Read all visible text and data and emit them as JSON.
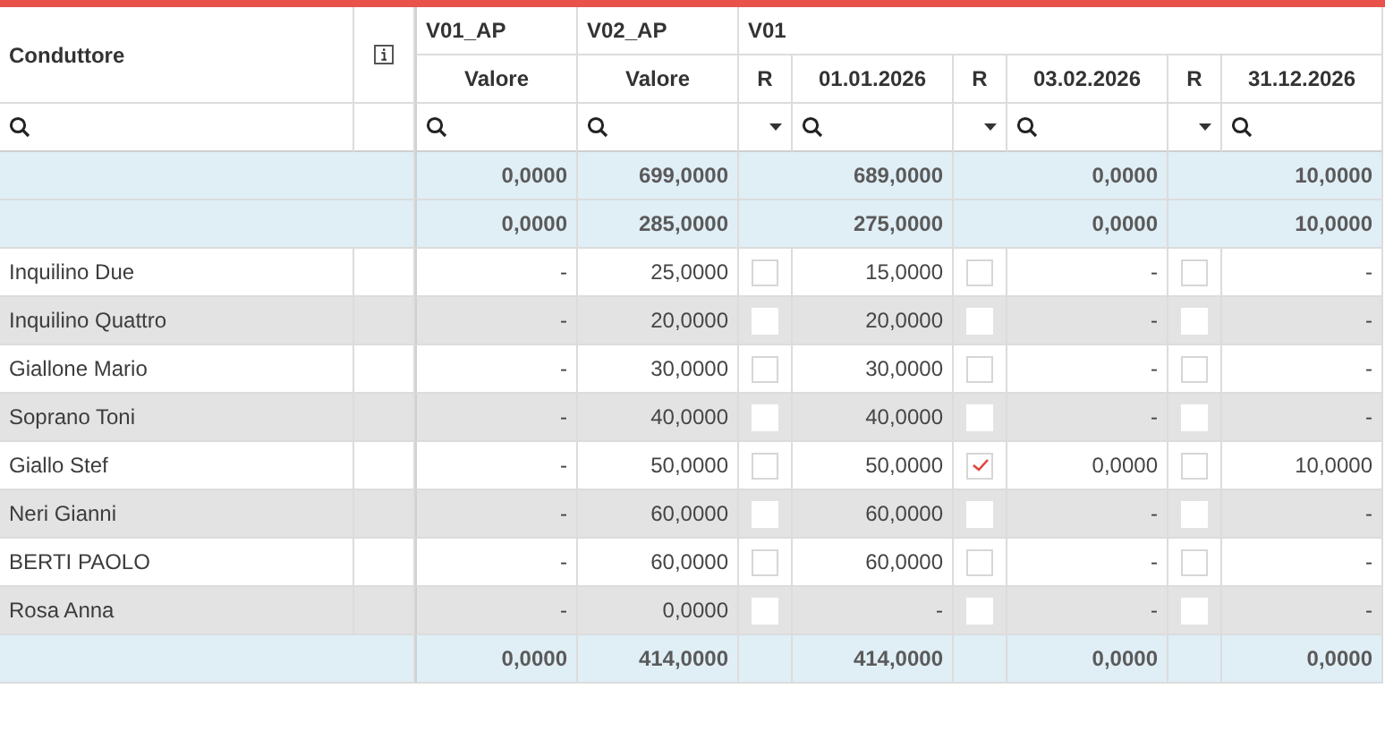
{
  "header": {
    "name_label": "Conduttore",
    "v01_ap": "V01_AP",
    "v01_ap_sub": "Valore",
    "v02_ap": "V02_AP",
    "v02_ap_sub": "Valore",
    "v01": "V01",
    "periods": [
      {
        "r": "R",
        "date": "01.01.2026"
      },
      {
        "r": "R",
        "date": "03.02.2026"
      },
      {
        "r": "R",
        "date": "31.12.2026"
      }
    ]
  },
  "summary_rows": [
    {
      "v01_ap": "0,0000",
      "v02_ap": "699,0000",
      "periods": [
        "689,0000",
        "0,0000",
        "10,0000"
      ]
    },
    {
      "v01_ap": "0,0000",
      "v02_ap": "285,0000",
      "periods": [
        "275,0000",
        "0,0000",
        "10,0000"
      ]
    }
  ],
  "rows": [
    {
      "name": "Inquilino Due",
      "v01_ap": "-",
      "v02_ap": "25,0000",
      "periods": [
        {
          "checked": false,
          "value": "15,0000"
        },
        {
          "checked": false,
          "value": "-"
        },
        {
          "checked": false,
          "value": "-"
        }
      ]
    },
    {
      "name": "Inquilino Quattro",
      "v01_ap": "-",
      "v02_ap": "20,0000",
      "periods": [
        {
          "checked": false,
          "value": "20,0000"
        },
        {
          "checked": false,
          "value": "-"
        },
        {
          "checked": false,
          "value": "-"
        }
      ]
    },
    {
      "name": "Giallone Mario",
      "v01_ap": "-",
      "v02_ap": "30,0000",
      "periods": [
        {
          "checked": false,
          "value": "30,0000"
        },
        {
          "checked": false,
          "value": "-"
        },
        {
          "checked": false,
          "value": "-"
        }
      ]
    },
    {
      "name": "Soprano Toni",
      "v01_ap": "-",
      "v02_ap": "40,0000",
      "periods": [
        {
          "checked": false,
          "value": "40,0000"
        },
        {
          "checked": false,
          "value": "-"
        },
        {
          "checked": false,
          "value": "-"
        }
      ]
    },
    {
      "name": "Giallo Stef",
      "v01_ap": "-",
      "v02_ap": "50,0000",
      "periods": [
        {
          "checked": false,
          "value": "50,0000"
        },
        {
          "checked": true,
          "value": "0,0000"
        },
        {
          "checked": false,
          "value": "10,0000"
        }
      ]
    },
    {
      "name": "Neri Gianni",
      "v01_ap": "-",
      "v02_ap": "60,0000",
      "periods": [
        {
          "checked": false,
          "value": "60,0000"
        },
        {
          "checked": false,
          "value": "-"
        },
        {
          "checked": false,
          "value": "-"
        }
      ]
    },
    {
      "name": "BERTI PAOLO",
      "v01_ap": "-",
      "v02_ap": "60,0000",
      "periods": [
        {
          "checked": false,
          "value": "60,0000"
        },
        {
          "checked": false,
          "value": "-"
        },
        {
          "checked": false,
          "value": "-"
        }
      ]
    },
    {
      "name": "Rosa Anna",
      "v01_ap": "-",
      "v02_ap": "0,0000",
      "periods": [
        {
          "checked": false,
          "value": "-"
        },
        {
          "checked": false,
          "value": "-"
        },
        {
          "checked": false,
          "value": "-"
        }
      ]
    }
  ],
  "footer": {
    "v01_ap": "0,0000",
    "v02_ap": "414,0000",
    "periods": [
      "414,0000",
      "0,0000",
      "0,0000"
    ]
  }
}
